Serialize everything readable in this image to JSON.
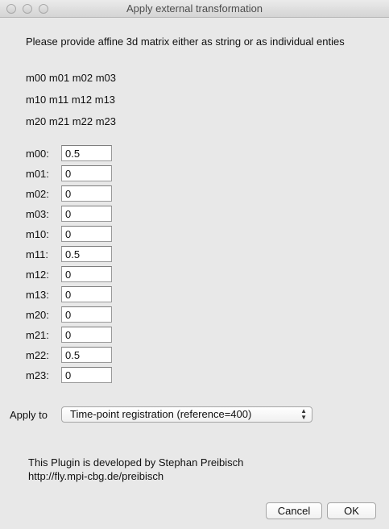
{
  "window": {
    "title": "Apply external transformation"
  },
  "instruction": "Please provide affine 3d matrix either as string or as individual enties",
  "matrix_rows": [
    "m00 m01 m02 m03",
    "m10 m11 m12 m13",
    "m20 m21 m22 m23"
  ],
  "fields": [
    {
      "label": "m00:",
      "value": "0.5"
    },
    {
      "label": "m01:",
      "value": "0"
    },
    {
      "label": "m02:",
      "value": "0"
    },
    {
      "label": "m03:",
      "value": "0"
    },
    {
      "label": "m10:",
      "value": "0"
    },
    {
      "label": "m11:",
      "value": "0.5"
    },
    {
      "label": "m12:",
      "value": "0"
    },
    {
      "label": "m13:",
      "value": "0"
    },
    {
      "label": "m20:",
      "value": "0"
    },
    {
      "label": "m21:",
      "value": "0"
    },
    {
      "label": "m22:",
      "value": "0.5"
    },
    {
      "label": "m23:",
      "value": "0"
    }
  ],
  "apply_to": {
    "label": "Apply to",
    "selected": "Time-point registration (reference=400)"
  },
  "footer": {
    "line1": "This Plugin is developed by Stephan Preibisch",
    "line2": "http://fly.mpi-cbg.de/preibisch"
  },
  "buttons": {
    "cancel": "Cancel",
    "ok": "OK"
  }
}
